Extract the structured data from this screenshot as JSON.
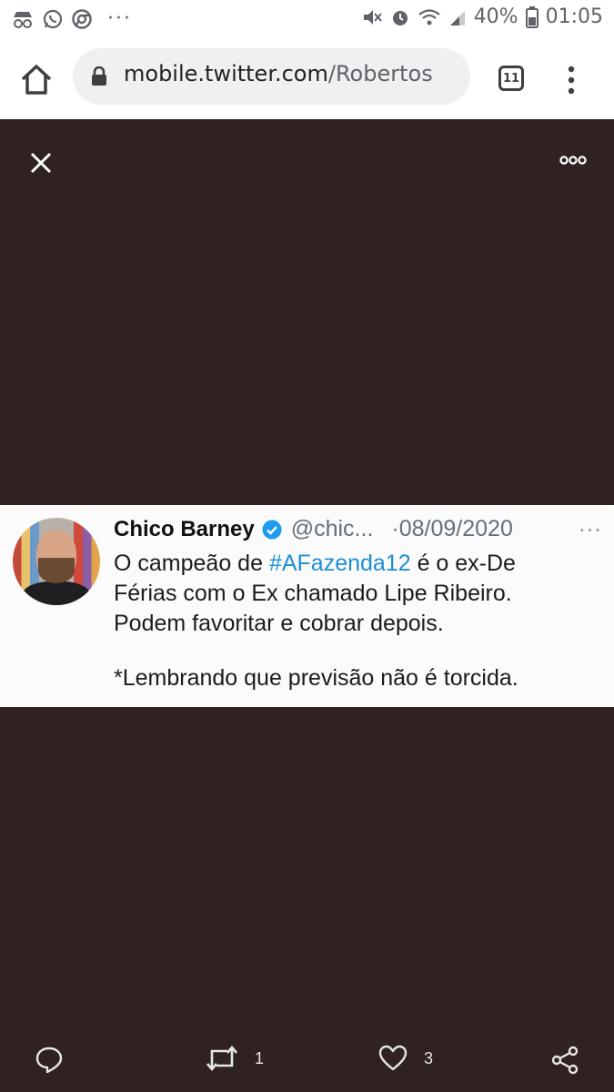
{
  "status_bar": {
    "battery": "40%",
    "time": "01:05",
    "overflow": "···"
  },
  "browser": {
    "url_domain": "mobile.twitter.com",
    "url_path": "/Robertos",
    "tab_count": "11"
  },
  "tweet": {
    "author_name": "Chico Barney",
    "handle": "@chic...",
    "date": "·08/09/2020",
    "more": "···",
    "line1_pre": "O campeão de ",
    "hashtag": "#AFazenda12",
    "line1_post": " é o ex-De",
    "line2": "Férias com o Ex chamado Lipe Ribeiro.",
    "line3": "Podem favoritar e cobrar depois.",
    "line4": "*Lembrando que previsão não é torcida."
  },
  "actions": {
    "retweet_count": "1",
    "like_count": "3"
  },
  "colors": {
    "background": "#2f2221",
    "hashtag": "#1d8fd6",
    "verified": "#1d9bf0"
  },
  "icons": [
    "incognito-icon",
    "whatsapp-icon",
    "chrome-icon",
    "mute-icon",
    "alarm-icon",
    "wifi-icon",
    "signal-icon",
    "battery-icon",
    "home-icon",
    "lock-icon",
    "tabs-icon",
    "menu-icon",
    "close-icon",
    "more-icon",
    "verified-icon",
    "reply-icon",
    "retweet-icon",
    "like-icon",
    "share-icon"
  ]
}
